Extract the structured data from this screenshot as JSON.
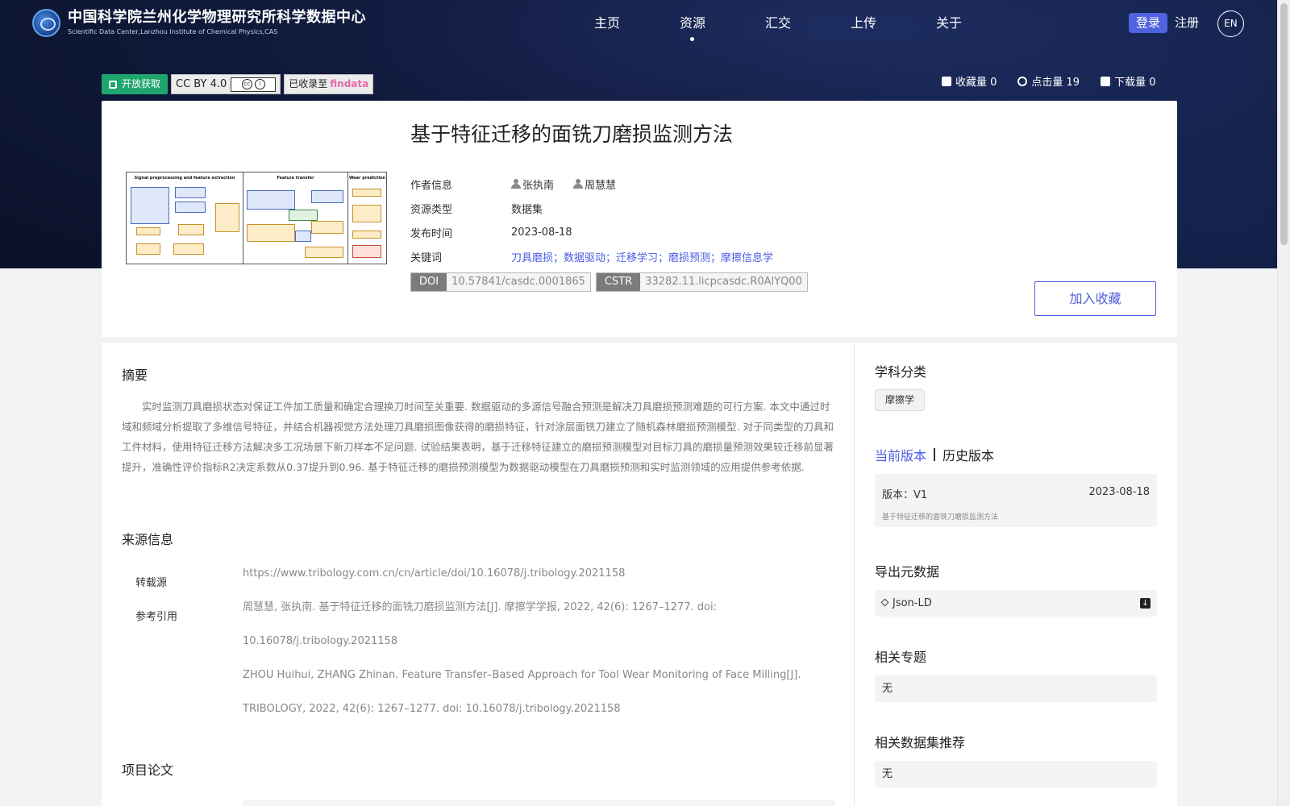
{
  "header": {
    "site_name_cn": "中国科学院兰州化学物理研究所科学数据中心",
    "site_name_en": "Scientific Data Center,Lanzhou Institute of Chemical Physics,CAS",
    "nav": [
      {
        "label": "主页",
        "active": false
      },
      {
        "label": "资源",
        "active": true
      },
      {
        "label": "汇交",
        "active": false
      },
      {
        "label": "上传",
        "active": false
      },
      {
        "label": "关于",
        "active": false
      }
    ],
    "login_label": "登录",
    "register_label": "注册",
    "lang_label": "EN"
  },
  "badges": {
    "open_access": "开放获取",
    "license": "CC BY 4.0",
    "indexed_prefix": "已收录至",
    "indexed_brand": "findata"
  },
  "stats": {
    "favorites": "收藏量 0",
    "views": "点击量 19",
    "downloads": "下载量 0"
  },
  "dataset": {
    "title": "基于特征迁移的面铣刀磨损监测方法",
    "meta": {
      "authors_label": "作者信息",
      "authors": [
        "张执南",
        "周慧慧"
      ],
      "type_label": "资源类型",
      "type": "数据集",
      "date_label": "发布时间",
      "date": "2023-08-18",
      "keywords_label": "关键词",
      "keywords": "刀具磨损；数据驱动；迁移学习；磨损预测；摩擦信息学"
    },
    "doi_key": "DOI",
    "doi_value": "10.57841/casdc.0001865",
    "cstr_key": "CSTR",
    "cstr_value": "33282.11.licpcasdc.R0AlYQ00",
    "favorite_button": "加入收藏",
    "thumbnail": {
      "col1_title": "Signal preprocessing and feature extraction",
      "col2_title": "Feature transfer",
      "col3_title": "Wear prediction"
    }
  },
  "abstract": {
    "title": "摘要",
    "text": "实时监测刀具磨损状态对保证工件加工质量和确定合理换刀时间至关重要. 数据驱动的多源信号融合预测是解决刀具磨损预测难题的可行方案. 本文中通过时域和频域分析提取了多维信号特征，并结合机器视觉方法处理刀具磨损图像获得的磨损特征，针对涂层面铣刀建立了随机森林磨损预测模型. 对于同类型的刀具和工件材料，使用特征迁移方法解决多工况场景下新刀样本不足问题. 试验结果表明，基于迁移特征建立的磨损预测模型对目标刀具的磨损量预测效果较迁移前显著提升，准确性评价指标R2决定系数从0.37提升到0.96. 基于特征迁移的磨损预测模型为数据驱动模型在刀具磨损预测和实时监测领域的应用提供参考依据."
  },
  "source": {
    "title": "来源信息",
    "repost_label": "转载源",
    "repost_value": "https://www.tribology.com.cn/cn/article/doi/10.16078/j.tribology.2021158",
    "cite_label": "参考引用",
    "cite_lines": [
      "周慧慧, 张执南. 基于特征迁移的面铣刀磨损监测方法[J]. 摩擦学学报, 2022, 42(6): 1267–1277. doi:",
      "10.16078/j.tribology.2021158",
      "ZHOU Huihui, ZHANG Zhinan. Feature Transfer–Based Approach for Tool Wear Monitoring of Face Milling[J].",
      "TRIBOLOGY, 2022, 42(6): 1267–1277. doi: 10.16078/j.tribology.2021158"
    ]
  },
  "papers": {
    "title": "项目论文"
  },
  "sidebar": {
    "subject_title": "学科分类",
    "subject_tag": "摩擦学",
    "current_version_tab": "当前版本",
    "history_version_tab": "历史版本",
    "version_label": "版本：V1",
    "version_date": "2023-08-18",
    "version_desc": "基于特征迁移的面铣刀磨损监测方法",
    "export_title": "导出元数据",
    "export_value": "Json-LD",
    "topics_title": "相关专题",
    "topics_value": "无",
    "recommend_title": "相关数据集推荐",
    "recommend_value": "无"
  }
}
